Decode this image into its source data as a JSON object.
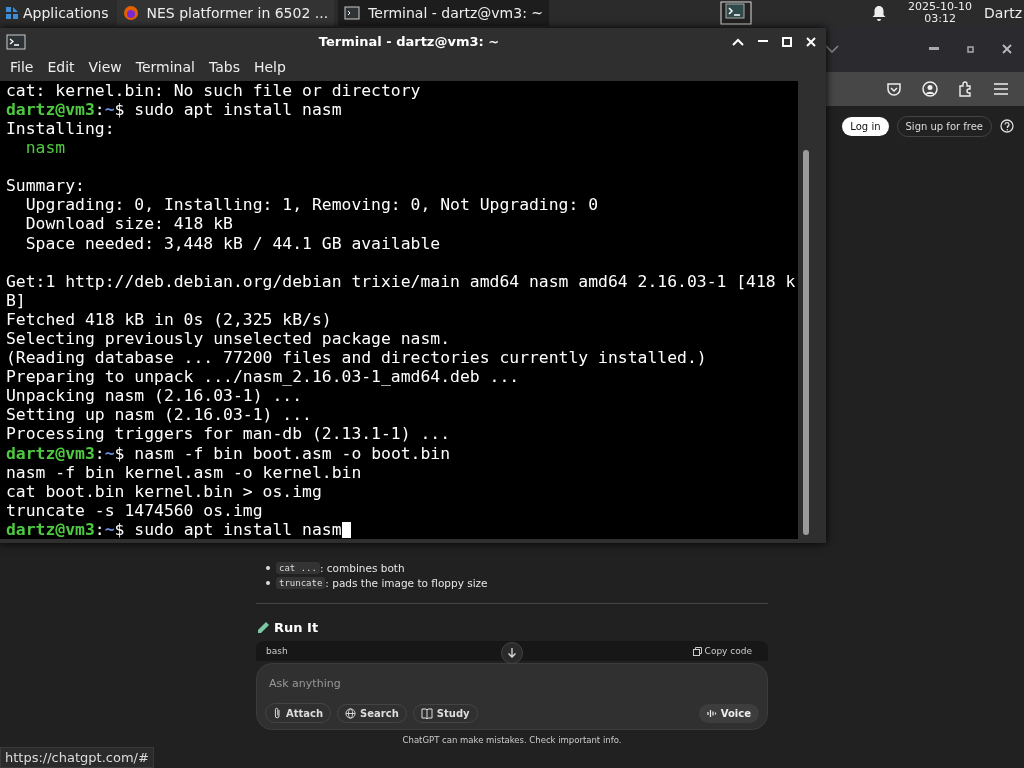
{
  "panel": {
    "apps_label": "Applications",
    "tasks": [
      {
        "title": "NES platformer in 6502 ...",
        "kind": "browser",
        "selected": false
      },
      {
        "title": "Terminal - dartz@vm3: ~",
        "kind": "terminal",
        "selected": true
      }
    ],
    "date": "2025-10-10",
    "time": "03:12",
    "user": "Dartz"
  },
  "browser": {
    "login": "Log in",
    "signup": "Sign up for free",
    "bullets": [
      {
        "code": "cat ...",
        "text": ": combines both"
      },
      {
        "code": "truncate",
        "text": ": pads the image to floppy size"
      }
    ],
    "heading": "Run It",
    "code_lang": "bash",
    "copy": "Copy code",
    "composer": {
      "placeholder": "Ask anything",
      "tools": [
        {
          "label": "Attach",
          "kind": "attach"
        },
        {
          "label": "Search",
          "kind": "globe"
        },
        {
          "label": "Study",
          "kind": "book"
        }
      ],
      "voice": "Voice"
    },
    "disclaimer": "ChatGPT can make mistakes. Check important info.",
    "status_url": "https://chatgpt.com/#"
  },
  "terminal": {
    "title": "Terminal - dartz@vm3: ~",
    "menu": [
      "File",
      "Edit",
      "View",
      "Terminal",
      "Tabs",
      "Help"
    ],
    "lines": [
      {
        "kind": "output",
        "text": "cat: kernel.bin: No such file or directory"
      },
      {
        "kind": "prompt",
        "user": "dartz@vm3",
        "sep": ":",
        "path": "~",
        "sigil": "$",
        "command": "sudo apt install nasm"
      },
      {
        "kind": "output",
        "text": "Installing:"
      },
      {
        "kind": "package",
        "text": "  nasm"
      },
      {
        "kind": "blank"
      },
      {
        "kind": "output",
        "text": "Summary:"
      },
      {
        "kind": "output",
        "text": "  Upgrading: 0, Installing: 1, Removing: 0, Not Upgrading: 0"
      },
      {
        "kind": "output",
        "text": "  Download size: 418 kB"
      },
      {
        "kind": "output",
        "text": "  Space needed: 3,448 kB / 44.1 GB available"
      },
      {
        "kind": "blank"
      },
      {
        "kind": "output",
        "text": "Get:1 http://deb.debian.org/debian trixie/main amd64 nasm amd64 2.16.03-1 [418 k"
      },
      {
        "kind": "output",
        "text": "B]"
      },
      {
        "kind": "output",
        "text": "Fetched 418 kB in 0s (2,325 kB/s)"
      },
      {
        "kind": "output",
        "text": "Selecting previously unselected package nasm."
      },
      {
        "kind": "output",
        "text": "(Reading database ... 77200 files and directories currently installed.)"
      },
      {
        "kind": "output",
        "text": "Preparing to unpack .../nasm_2.16.03-1_amd64.deb ..."
      },
      {
        "kind": "output",
        "text": "Unpacking nasm (2.16.03-1) ..."
      },
      {
        "kind": "output",
        "text": "Setting up nasm (2.16.03-1) ..."
      },
      {
        "kind": "output",
        "text": "Processing triggers for man-db (2.13.1-1) ..."
      },
      {
        "kind": "prompt",
        "user": "dartz@vm3",
        "sep": ":",
        "path": "~",
        "sigil": "$",
        "command": "nasm -f bin boot.asm -o boot.bin"
      },
      {
        "kind": "output",
        "text": "nasm -f bin kernel.asm -o kernel.bin"
      },
      {
        "kind": "output",
        "text": "cat boot.bin kernel.bin > os.img"
      },
      {
        "kind": "output",
        "text": "truncate -s 1474560 os.img"
      },
      {
        "kind": "prompt",
        "user": "dartz@vm3",
        "sep": ":",
        "path": "~",
        "sigil": "$",
        "command": "sudo apt install nasm",
        "cursor": true
      }
    ]
  }
}
